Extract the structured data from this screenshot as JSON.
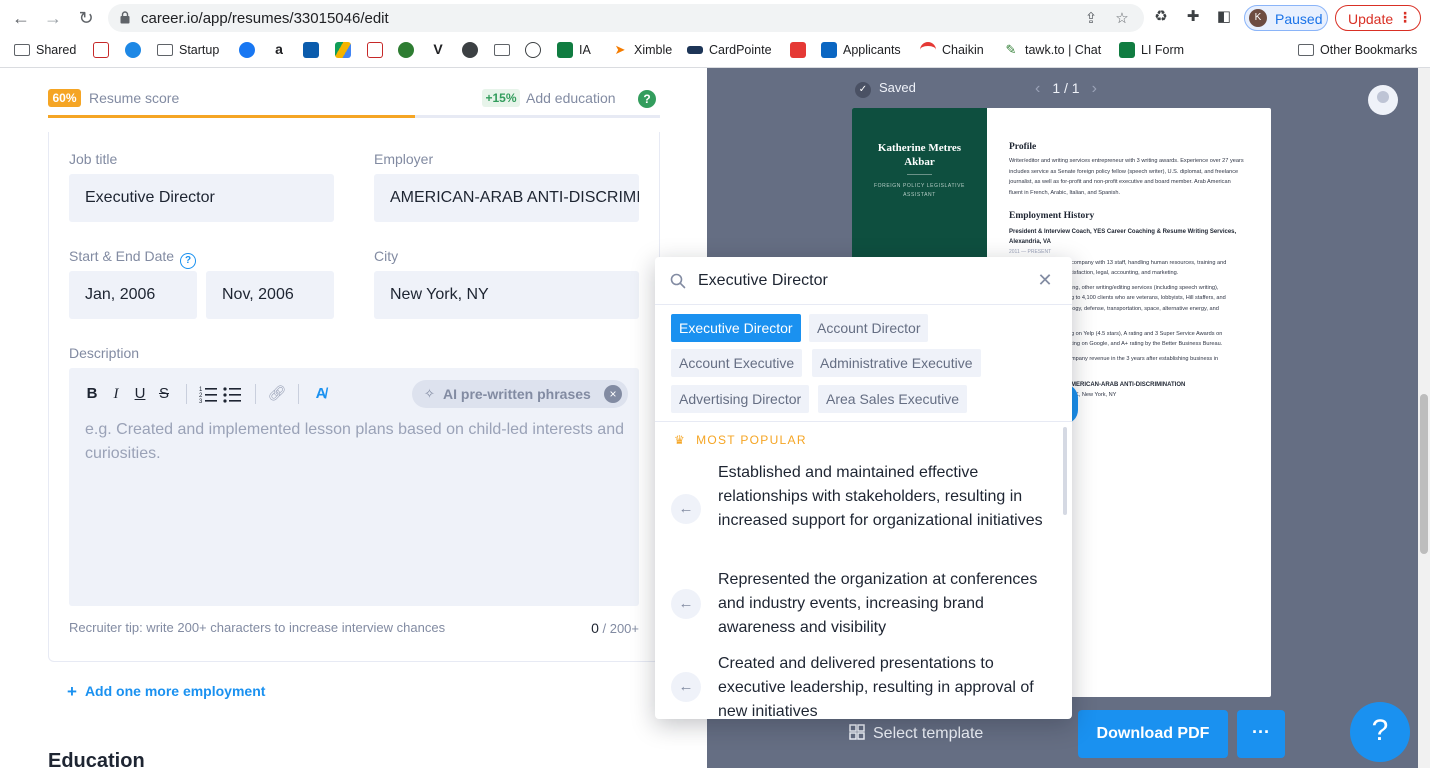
{
  "browser": {
    "url": "career.io/app/resumes/33015046/edit",
    "profile_initial": "K",
    "profile_status": "Paused",
    "update_label": "Update",
    "bookmarks": [
      "Shared",
      "Startup",
      "IA",
      "Ximble",
      "CardPointe",
      "Applicants",
      "Chaikin",
      "tawk.to | Chat",
      "LI Form"
    ],
    "other_bookmarks": "Other Bookmarks"
  },
  "score": {
    "badge": "60%",
    "label": "Resume score",
    "progress_fraction": 0.6,
    "bonus_badge": "+15%",
    "bonus_label": "Add education",
    "help": "?"
  },
  "form": {
    "job_title_label": "Job title",
    "job_title_value": "Executive Director",
    "employer_label": "Employer",
    "employer_value": "AMERICAN-ARAB ANTI-DISCRIMINATION",
    "dates_label": "Start & End Date",
    "start_date": "Jan, 2006",
    "end_date": "Nov, 2006",
    "city_label": "City",
    "city_value": "New York, NY",
    "description_label": "Description",
    "toolbar": {
      "bold": "B",
      "italic": "I",
      "underline": "U",
      "strike": "S"
    },
    "ai_phrases_label": "AI pre-written phrases",
    "description_placeholder": "e.g. Created and implemented lesson plans based on child-led interests and curiosities.",
    "tip": "Recruiter tip: write 200+ characters to increase interview chances",
    "char_count": "0",
    "char_target": "/ 200+",
    "add_employment": "Add one more employment",
    "education_heading": "Education"
  },
  "preview": {
    "saved": "Saved",
    "page_indicator": "1 / 1",
    "resume_name": "Katherine Metres Akbar",
    "resume_subtitle": "FOREIGN POLICY LEGISLATIVE ASSISTANT",
    "profile_heading": "Profile",
    "profile_text": "Writer/editor and writing services entrepreneur with 3 writing awards. Experience over 27 years includes service as Senate foreign policy fellow (speech writer), U.S. diplomat, and freelance journalist, as well as for-profit and non-profit executive and board member. Arab American fluent in French, Arabic, Italian, and Spanish.",
    "history_heading": "Employment History",
    "history_role": "President & Interview Coach, YES Career Coaching & Resume Writing Services, Alexandria, VA",
    "history_dates": "2011 — PRESENT",
    "snippets": [
      "company with 13 staff, handling human resources, training and",
      "tisfaction, legal, accounting, and marketing.",
      "ing, other writing/editing services (including speech writing),",
      "g to 4,100 clients who are veterans, lobbyists, Hill staffers, and",
      "logy, defense, transportation, space, alternative energy, and",
      "g on Yelp (4.5 stars), A rating and 3 Super Service Awards on",
      "ting on Google, and A+ rating by the Better Business Bureau.",
      "mpany revenue in the 3 years after establishing business in"
    ],
    "employer_snippet": "MERICAN-ARAB ANTI-DISCRIMINATION",
    "city_snippet": "RK, New York, NY",
    "select_template": "Select template",
    "download": "Download PDF",
    "more": "···",
    "help": "?"
  },
  "popup": {
    "query": "Executive Director",
    "chips": [
      "Executive Director",
      "Account Director",
      "Account Executive",
      "Administrative Executive",
      "Advertising Director",
      "Area Sales Executive"
    ],
    "section_label": "MOST POPULAR",
    "phrases": [
      "Established and maintained effective relationships with stakeholders, resulting in increased support for organizational initiatives",
      "Represented the organization at conferences and industry events, increasing brand awareness and visibility",
      "Created and delivered presentations to executive leadership, resulting in approval of new initiatives"
    ]
  },
  "colors": {
    "accent": "#1a91f0",
    "score": "#f5a524",
    "positive": "#339d5d",
    "preview_bg": "#656e83",
    "resume_sidebar": "#0e4f3f"
  }
}
